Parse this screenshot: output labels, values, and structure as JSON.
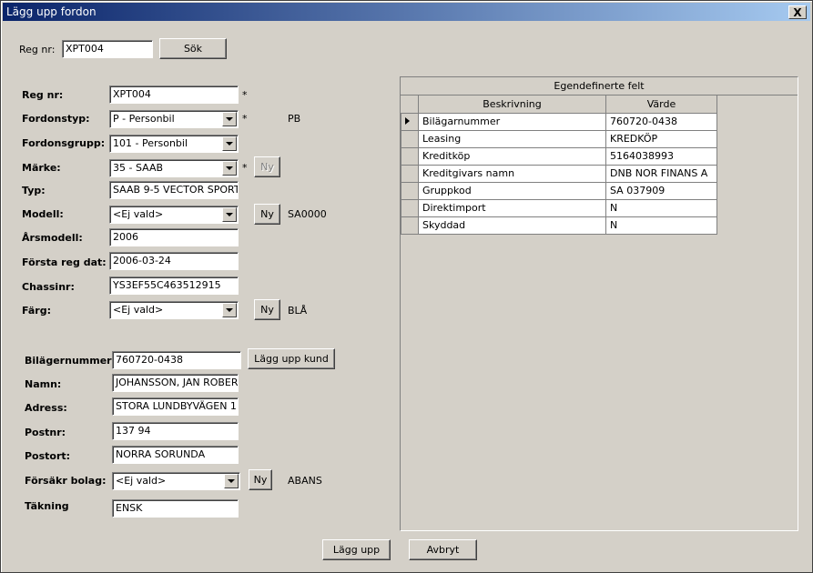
{
  "window": {
    "title": "Lägg upp fordon",
    "close_label": "X"
  },
  "search": {
    "label": "Reg nr:",
    "value": "XPT004",
    "button": "Sök"
  },
  "vehicle": {
    "reg_label": "Reg nr:",
    "reg_value": "XPT004",
    "fordonstyp_label": "Fordonstyp:",
    "fordonstyp_value": "P - Personbil",
    "fordonstyp_code": "PB",
    "fordonsgrupp_label": "Fordonsgrupp:",
    "fordonsgrupp_value": "101 - Personbil",
    "marke_label": "Märke:",
    "marke_value": "35 - SAAB",
    "marke_new": "Ny",
    "typ_label": "Typ:",
    "typ_value": "SAAB 9-5 VECTOR SPORT",
    "modell_label": "Modell:",
    "modell_value": "<Ej vald>",
    "modell_new": "Ny",
    "modell_code": "SA0000",
    "arsmodell_label": "Årsmodell:",
    "arsmodell_value": "2006",
    "forsta_label": "Första reg dat:",
    "forsta_value": "2006-03-24",
    "chassi_label": "Chassinr:",
    "chassi_value": "YS3EF55C463512915",
    "farg_label": "Färg:",
    "farg_value": "<Ej vald>",
    "farg_new": "Ny",
    "farg_code": "BLÅ",
    "required_mark": "*"
  },
  "customer": {
    "bilagare_label": "Bilägernummer:",
    "bilagare_value": "760720-0438",
    "add_customer": "Lägg upp kund",
    "namn_label": "Namn:",
    "namn_value": "JOHANSSON, JAN ROBER",
    "adress_label": "Adress:",
    "adress_value": "STORA LUNDBYVÄGEN 1",
    "postnr_label": "Postnr:",
    "postnr_value": "137 94",
    "postort_label": "Postort:",
    "postort_value": "NORRA SORUNDA",
    "forsakr_label": "Försäkr bolag:",
    "forsakr_value": "<Ej vald>",
    "forsakr_new": "Ny",
    "forsakr_code": "ABANS",
    "takning_label": "Täkning",
    "takning_value": "ENSK"
  },
  "custom_fields": {
    "caption": "Egendefinerte felt",
    "col_desc": "Beskrivning",
    "col_value": "Värde",
    "rows": [
      {
        "desc": "Bilägarnummer",
        "value": "760720-0438"
      },
      {
        "desc": "Leasing",
        "value": "KREDKÖP"
      },
      {
        "desc": "Kreditköp",
        "value": "5164038993"
      },
      {
        "desc": "Kreditgivars namn",
        "value": "DNB NOR FINANS A"
      },
      {
        "desc": "Gruppkod",
        "value": "SA 037909"
      },
      {
        "desc": "Direktimport",
        "value": "N"
      },
      {
        "desc": "Skyddad",
        "value": "N"
      }
    ]
  },
  "footer": {
    "save": "Lägg upp",
    "cancel": "Avbryt"
  }
}
